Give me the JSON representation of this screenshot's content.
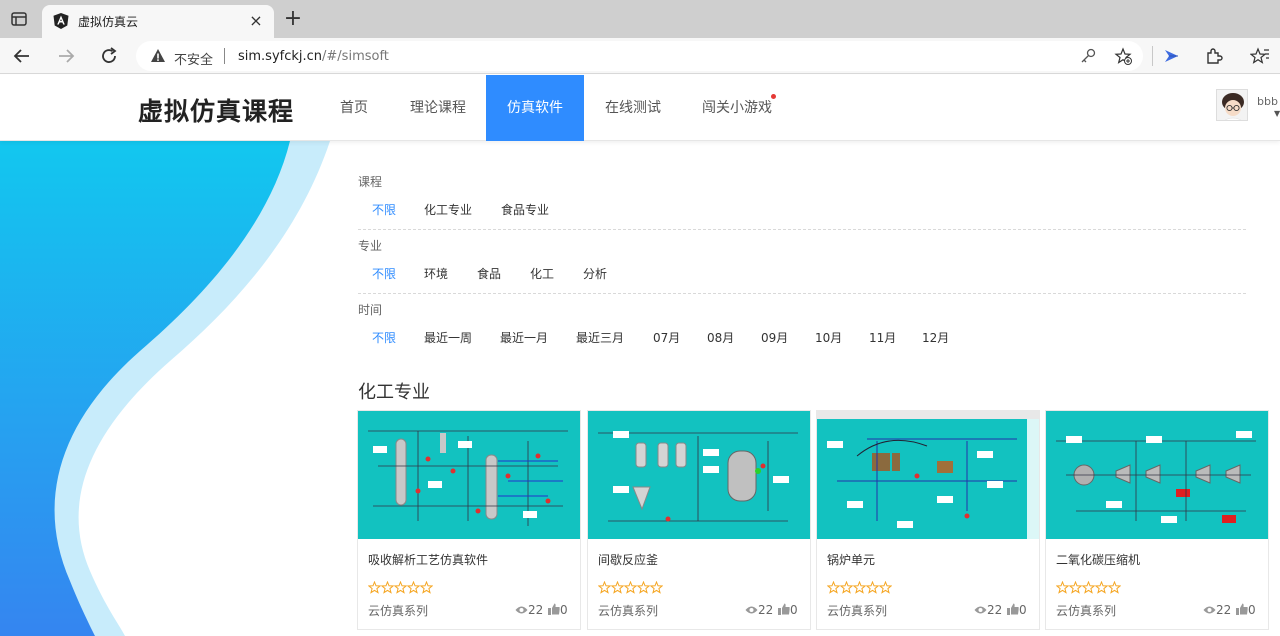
{
  "browser": {
    "tab_title": "虚拟仿真云",
    "tab_close": "×",
    "new_tab": "+",
    "insecure_label": "不安全",
    "url_host": "sim.syfckj.cn",
    "url_path": "/#/simsoft"
  },
  "header": {
    "logo": "虚拟仿真课程",
    "nav": [
      {
        "label": "首页"
      },
      {
        "label": "理论课程"
      },
      {
        "label": "仿真软件"
      },
      {
        "label": "在线测试"
      },
      {
        "label": "闯关小游戏"
      }
    ],
    "active_index": 2,
    "username": "bbb"
  },
  "filters": {
    "course": {
      "title": "课程",
      "options": [
        "不限",
        "化工专业",
        "食品专业"
      ]
    },
    "major": {
      "title": "专业",
      "options": [
        "不限",
        "环境",
        "食品",
        "化工",
        "分析"
      ]
    },
    "time": {
      "title": "时间",
      "options": [
        "不限",
        "最近一周",
        "最近一月",
        "最近三月",
        "07月",
        "08月",
        "09月",
        "10月",
        "11月",
        "12月"
      ]
    }
  },
  "section": {
    "title": "化工专业",
    "cards": [
      {
        "name": "吸收解析工艺仿真软件",
        "series": "云仿真系列",
        "views": "22",
        "likes": "0",
        "rating": 0
      },
      {
        "name": "间歇反应釜",
        "series": "云仿真系列",
        "views": "22",
        "likes": "0",
        "rating": 0
      },
      {
        "name": "锅炉单元",
        "series": "云仿真系列",
        "views": "22",
        "likes": "0",
        "rating": 0
      },
      {
        "name": "二氧化碳压缩机",
        "series": "云仿真系列",
        "views": "22",
        "likes": "0",
        "rating": 0
      }
    ]
  },
  "colors": {
    "accent": "#2f8cff",
    "card_image_bg": "#12c2c0",
    "star": "#f5a623",
    "wave_dark": "#2a8df2",
    "wave_light": "#c8ecfb"
  }
}
